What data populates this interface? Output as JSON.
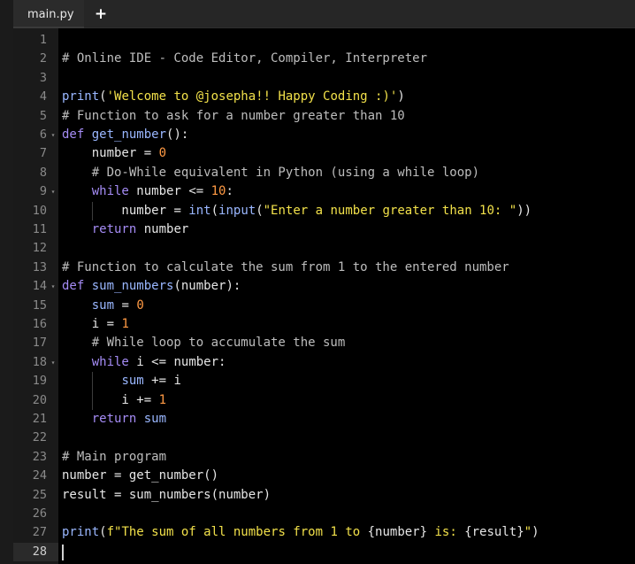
{
  "tabs": {
    "active_label": "main.py",
    "add_label": "+"
  },
  "editor": {
    "lines": [
      {
        "n": "1",
        "fold": false,
        "tokens": []
      },
      {
        "n": "2",
        "fold": false,
        "tokens": [
          {
            "t": "cm",
            "v": "# Online IDE - Code Editor, Compiler, Interpreter"
          }
        ]
      },
      {
        "n": "3",
        "fold": false,
        "tokens": []
      },
      {
        "n": "4",
        "fold": false,
        "tokens": [
          {
            "t": "fn",
            "v": "print"
          },
          {
            "t": "op",
            "v": "("
          },
          {
            "t": "st",
            "v": "'Welcome to @josepha!! Happy Coding :)'"
          },
          {
            "t": "op",
            "v": ")"
          }
        ]
      },
      {
        "n": "5",
        "fold": false,
        "tokens": [
          {
            "t": "cm",
            "v": "# Function to ask for a number greater than 10"
          }
        ]
      },
      {
        "n": "6",
        "fold": true,
        "tokens": [
          {
            "t": "kw",
            "v": "def"
          },
          {
            "t": "tx",
            "v": " "
          },
          {
            "t": "fn",
            "v": "get_number"
          },
          {
            "t": "op",
            "v": "():"
          }
        ]
      },
      {
        "n": "7",
        "fold": false,
        "tokens": [
          {
            "t": "tx",
            "v": "    number "
          },
          {
            "t": "op",
            "v": "= "
          },
          {
            "t": "nm",
            "v": "0"
          }
        ]
      },
      {
        "n": "8",
        "fold": false,
        "tokens": [
          {
            "t": "cm",
            "v": "    # Do-While equivalent in Python (using a while loop)"
          }
        ]
      },
      {
        "n": "9",
        "fold": true,
        "tokens": [
          {
            "t": "tx",
            "v": "    "
          },
          {
            "t": "kw",
            "v": "while"
          },
          {
            "t": "tx",
            "v": " number "
          },
          {
            "t": "op",
            "v": "<= "
          },
          {
            "t": "nm",
            "v": "10"
          },
          {
            "t": "op",
            "v": ":"
          }
        ]
      },
      {
        "n": "10",
        "fold": false,
        "tokens": [
          {
            "t": "tx",
            "v": "        number "
          },
          {
            "t": "op",
            "v": "= "
          },
          {
            "t": "fn",
            "v": "int"
          },
          {
            "t": "op",
            "v": "("
          },
          {
            "t": "fn",
            "v": "input"
          },
          {
            "t": "op",
            "v": "("
          },
          {
            "t": "st",
            "v": "\"Enter a number greater than 10: \""
          },
          {
            "t": "op",
            "v": "))"
          }
        ]
      },
      {
        "n": "11",
        "fold": false,
        "tokens": [
          {
            "t": "tx",
            "v": "    "
          },
          {
            "t": "kw",
            "v": "return"
          },
          {
            "t": "tx",
            "v": " number"
          }
        ]
      },
      {
        "n": "12",
        "fold": false,
        "tokens": []
      },
      {
        "n": "13",
        "fold": false,
        "tokens": [
          {
            "t": "cm",
            "v": "# Function to calculate the sum from 1 to the entered number"
          }
        ]
      },
      {
        "n": "14",
        "fold": true,
        "tokens": [
          {
            "t": "kw",
            "v": "def"
          },
          {
            "t": "tx",
            "v": " "
          },
          {
            "t": "fn",
            "v": "sum_numbers"
          },
          {
            "t": "op",
            "v": "(number):"
          }
        ]
      },
      {
        "n": "15",
        "fold": false,
        "tokens": [
          {
            "t": "tx",
            "v": "    "
          },
          {
            "t": "fn",
            "v": "sum"
          },
          {
            "t": "op",
            "v": " = "
          },
          {
            "t": "nm",
            "v": "0"
          }
        ]
      },
      {
        "n": "16",
        "fold": false,
        "tokens": [
          {
            "t": "tx",
            "v": "    i "
          },
          {
            "t": "op",
            "v": "= "
          },
          {
            "t": "nm",
            "v": "1"
          }
        ]
      },
      {
        "n": "17",
        "fold": false,
        "tokens": [
          {
            "t": "cm",
            "v": "    # While loop to accumulate the sum"
          }
        ]
      },
      {
        "n": "18",
        "fold": true,
        "tokens": [
          {
            "t": "tx",
            "v": "    "
          },
          {
            "t": "kw",
            "v": "while"
          },
          {
            "t": "tx",
            "v": " i "
          },
          {
            "t": "op",
            "v": "<= "
          },
          {
            "t": "tx",
            "v": "number:"
          }
        ]
      },
      {
        "n": "19",
        "fold": false,
        "tokens": [
          {
            "t": "tx",
            "v": "        "
          },
          {
            "t": "fn",
            "v": "sum"
          },
          {
            "t": "op",
            "v": " += "
          },
          {
            "t": "tx",
            "v": "i"
          }
        ]
      },
      {
        "n": "20",
        "fold": false,
        "tokens": [
          {
            "t": "tx",
            "v": "        i "
          },
          {
            "t": "op",
            "v": "+= "
          },
          {
            "t": "nm",
            "v": "1"
          }
        ]
      },
      {
        "n": "21",
        "fold": false,
        "tokens": [
          {
            "t": "tx",
            "v": "    "
          },
          {
            "t": "kw",
            "v": "return"
          },
          {
            "t": "tx",
            "v": " "
          },
          {
            "t": "fn",
            "v": "sum"
          }
        ]
      },
      {
        "n": "22",
        "fold": false,
        "tokens": []
      },
      {
        "n": "23",
        "fold": false,
        "tokens": [
          {
            "t": "cm",
            "v": "# Main program"
          }
        ]
      },
      {
        "n": "24",
        "fold": false,
        "tokens": [
          {
            "t": "tx",
            "v": "number "
          },
          {
            "t": "op",
            "v": "= "
          },
          {
            "t": "tx",
            "v": "get_number()"
          }
        ]
      },
      {
        "n": "25",
        "fold": false,
        "tokens": [
          {
            "t": "tx",
            "v": "result "
          },
          {
            "t": "op",
            "v": "= "
          },
          {
            "t": "tx",
            "v": "sum_numbers(number)"
          }
        ]
      },
      {
        "n": "26",
        "fold": false,
        "tokens": []
      },
      {
        "n": "27",
        "fold": false,
        "tokens": [
          {
            "t": "fn",
            "v": "print"
          },
          {
            "t": "op",
            "v": "("
          },
          {
            "t": "st",
            "v": "f\"The sum of all numbers from 1 to "
          },
          {
            "t": "tx",
            "v": "{number} "
          },
          {
            "t": "st",
            "v": "is: "
          },
          {
            "t": "tx",
            "v": "{result}"
          },
          {
            "t": "st",
            "v": "\""
          },
          {
            "t": "op",
            "v": ")"
          }
        ]
      },
      {
        "n": "28",
        "fold": false,
        "tokens": []
      }
    ],
    "active_line": "28",
    "fold_glyph": "▾"
  },
  "colors": {
    "background": "#000000",
    "gutter": "#1a1a1a",
    "comment": "#bdbdbd",
    "keyword": "#a58cf5",
    "function": "#9ab7ff",
    "string": "#f2e14a",
    "number": "#ff9a44"
  }
}
